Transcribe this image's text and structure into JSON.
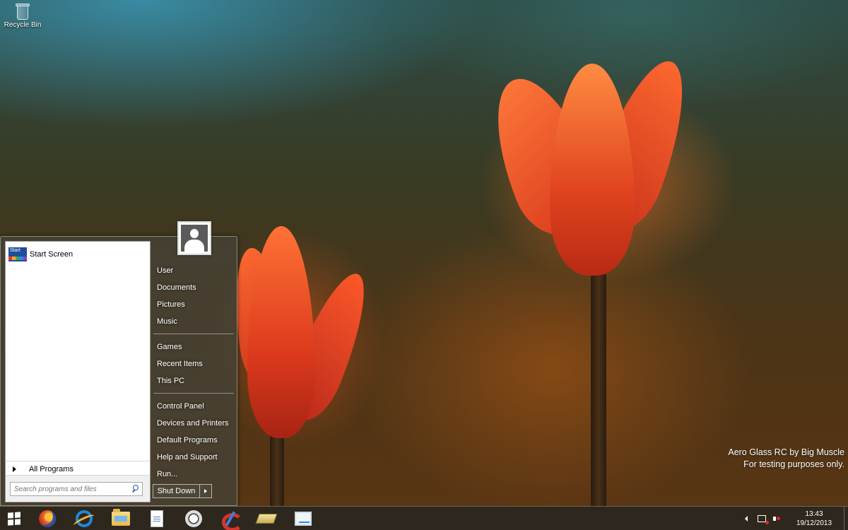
{
  "desktop": {
    "icons": [
      {
        "label": "Recycle Bin",
        "icon": "recycle-bin-icon"
      }
    ],
    "watermark": {
      "line1": "Aero Glass RC by Big Muscle",
      "line2": "For testing purposes only."
    }
  },
  "start_menu": {
    "pinned": [
      {
        "label": "Start Screen",
        "icon": "start-screen-icon",
        "icon_text": "Start"
      }
    ],
    "all_programs_label": "All Programs",
    "search": {
      "placeholder": "Search programs and files"
    },
    "user_picture": "user-picture",
    "places_group1": [
      "User",
      "Documents",
      "Pictures",
      "Music"
    ],
    "places_group2": [
      "Games",
      "Recent Items",
      "This PC"
    ],
    "places_group3": [
      "Control Panel",
      "Devices and Printers",
      "Default Programs",
      "Help and Support",
      "Run..."
    ],
    "shutdown_label": "Shut Down"
  },
  "taskbar": {
    "apps": [
      "windows-start-icon",
      "firefox-icon",
      "internet-explorer-icon",
      "file-explorer-icon",
      "document-icon",
      "media-player-icon",
      "ccleaner-icon",
      "drive-icon",
      "monitor-icon"
    ],
    "clock": {
      "time": "13:43",
      "date": "19/12/2013"
    }
  },
  "colors": {
    "start_menu_glass": "#46423680",
    "accent_blue": "#1c5fa8"
  }
}
